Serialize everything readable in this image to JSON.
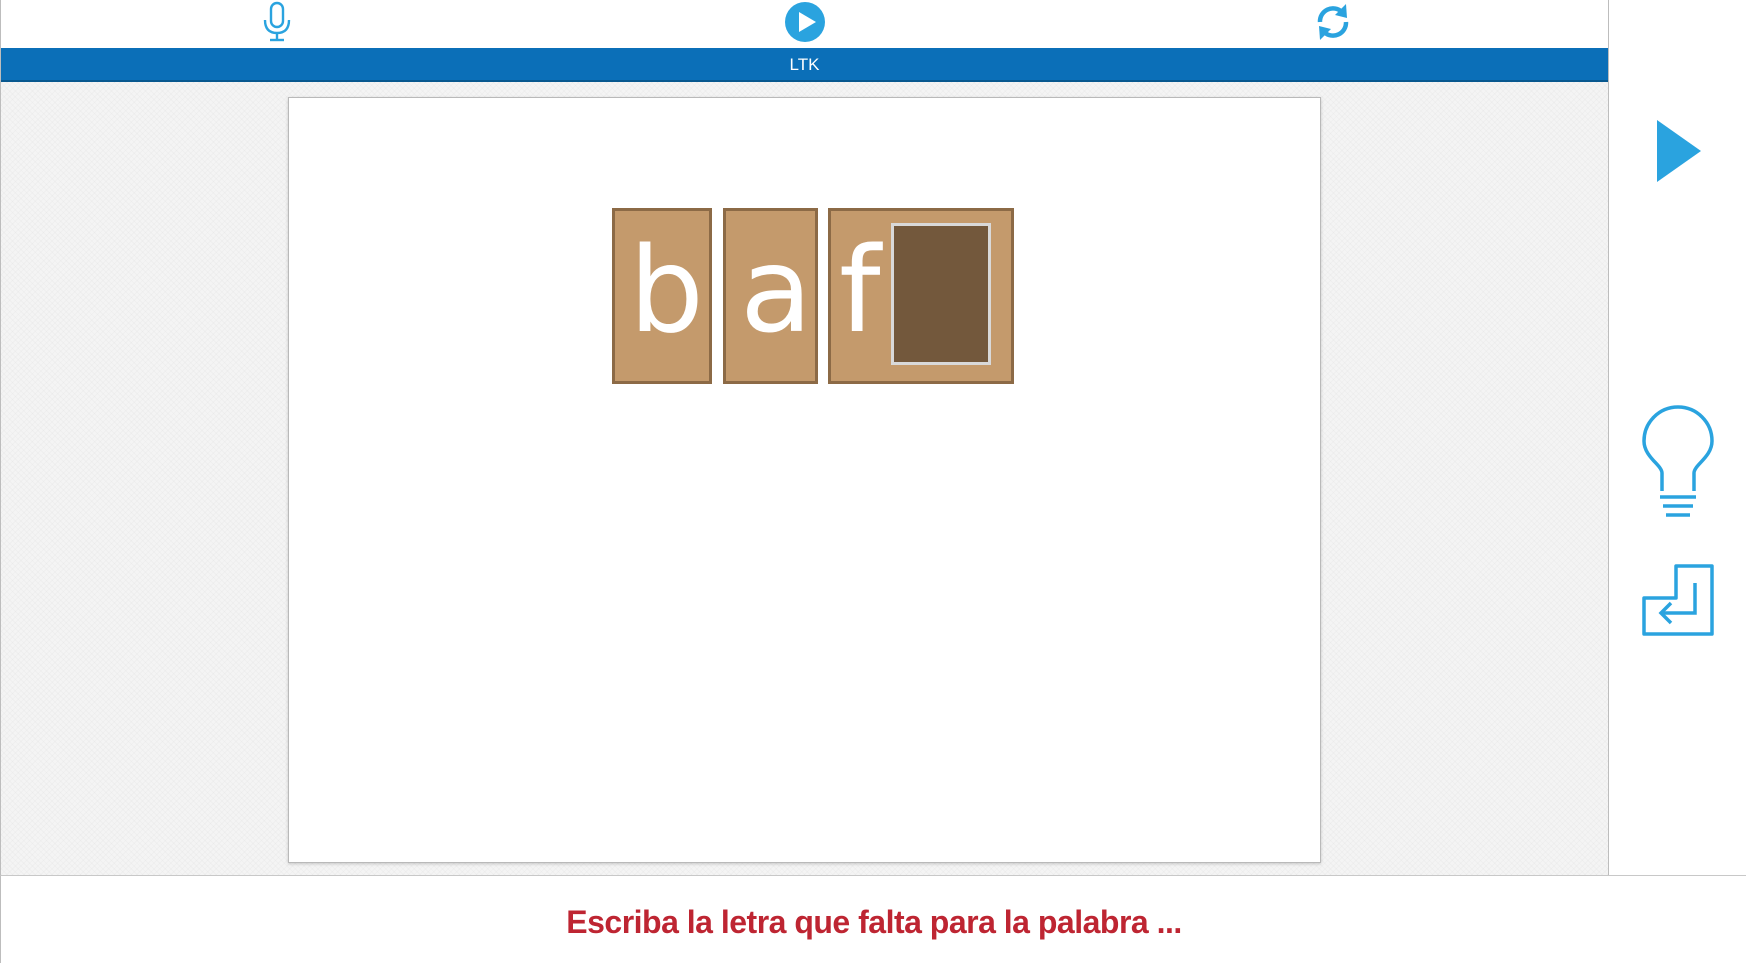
{
  "toolbar": {
    "icons": [
      "microphone-icon",
      "play-circle-icon",
      "refresh-icon"
    ]
  },
  "titlebar": {
    "title": "LTK"
  },
  "exercise": {
    "tiles": [
      {
        "letter": "b"
      },
      {
        "letter": "a"
      },
      {
        "letter": "f",
        "blank_value": ""
      }
    ],
    "colors": {
      "tile_fill": "#c49a6c",
      "tile_border": "#8c6a46",
      "blank_fill": "#73583c",
      "letter": "#ffffff"
    }
  },
  "sidebar": {
    "icons": [
      "next-arrow-icon",
      "hint-lightbulb-icon",
      "enter-return-icon"
    ]
  },
  "footer": {
    "prompt": "Escriba la letra que falta para la palabra ..."
  },
  "theme": {
    "accent": "#2aa3df",
    "header_bar": "#0b6fb8",
    "prompt_color": "#be2532"
  }
}
